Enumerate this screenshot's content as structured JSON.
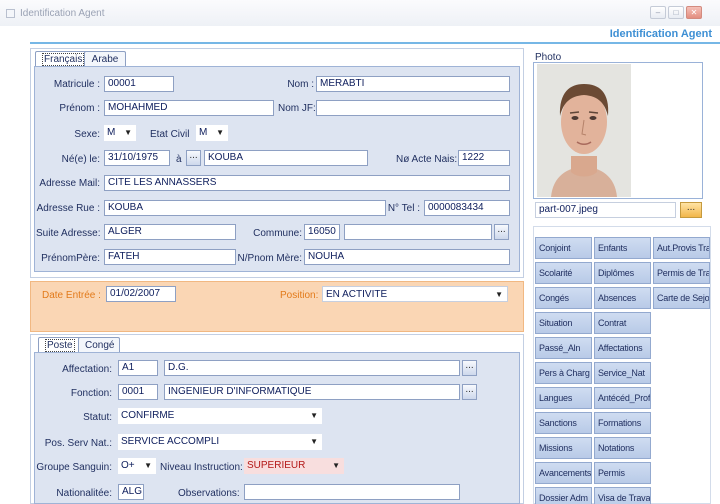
{
  "window": {
    "title": "Identification Agent",
    "app_title": "Identification Agent"
  },
  "tabs_lang": [
    "Français",
    "Arabe"
  ],
  "identity": {
    "matricule_label": "Matricule :",
    "matricule": "00001",
    "nom_label": "Nom :",
    "nom": "MERABTI",
    "prenom_label": "Prénom :",
    "prenom": "MOHAHMED",
    "nomjf_label": "Nom JF:",
    "nomjf": "",
    "sexe_label": "Sexe:",
    "sexe": "M",
    "etat_civil_label": "Etat Civil",
    "etat_civil": "M",
    "ne_le_label": "Né(e) le:",
    "ne_le": "31/10/1975",
    "a_label": "à",
    "lieu": "KOUBA",
    "acte_label": "Nø Acte Nais:",
    "acte": "1222",
    "mail_label": "Adresse Mail:",
    "mail": "CITE LES ANNASSERS",
    "rue_label": "Adresse Rue :",
    "rue": "KOUBA",
    "tel_label": "N° Tel :",
    "tel": "0000083434",
    "suite_label": "Suite Adresse:",
    "suite": "ALGER",
    "commune_label": "Commune:",
    "commune_code": "16050",
    "commune_name": "",
    "pere_label": "PrénomPère:",
    "pere": "FATEH",
    "mere_label": "N/Pnom Mère:",
    "mere": "NOUHA"
  },
  "photo": {
    "label": "Photo",
    "filename": "part-007.jpeg",
    "browse": "..."
  },
  "entree": {
    "date_label": "Date Entrée :",
    "date": "01/02/2007",
    "position_label": "Position:",
    "position": "EN ACTIVITE"
  },
  "tabs_poste": [
    "Poste",
    "Congé"
  ],
  "poste": {
    "affectation_label": "Affectation:",
    "affectation_code": "A1",
    "affectation": "D.G.",
    "fonction_label": "Fonction:",
    "fonction_code": "0001",
    "fonction": "INGENIEUR D'INFORMATIQUE",
    "statut_label": "Statut:",
    "statut": "CONFIRME",
    "serv_nat_label": "Pos. Serv Nat.:",
    "serv_nat": "SERVICE ACCOMPLI",
    "sanguin_label": "Groupe Sanguin:",
    "sanguin": "O+",
    "niveau_label": "Niveau Instruction:",
    "niveau": "SUPERIEUR",
    "nationalite_label": "Nationalitée:",
    "nationalite": "ALG",
    "observations_label": "Observations:",
    "observations": ""
  },
  "side_buttons": [
    [
      "Conjoint",
      "Enfants",
      "Aut.Provis Trav"
    ],
    [
      "Scolarité",
      "Diplômes",
      "Permis de Trav"
    ],
    [
      "Congés",
      "Absences",
      "Carte de Sejour"
    ],
    [
      "Situation",
      "Contrat"
    ],
    [
      "Passé_Aln",
      "Affectations"
    ],
    [
      "Pers à Charg",
      "Service_Nat"
    ],
    [
      "Langues",
      "Antécéd_Prof"
    ],
    [
      "Sanctions",
      "Formations"
    ],
    [
      "Missions",
      "Notations"
    ],
    [
      "Avancements",
      "Permis"
    ],
    [
      "Dossier Adm",
      "Visa de Travail"
    ]
  ],
  "colors": {
    "accent": "#3d8fd4",
    "panel": "#dde4f1",
    "orange_panel": "#fad6b4",
    "orange_text": "#e27a1a"
  }
}
